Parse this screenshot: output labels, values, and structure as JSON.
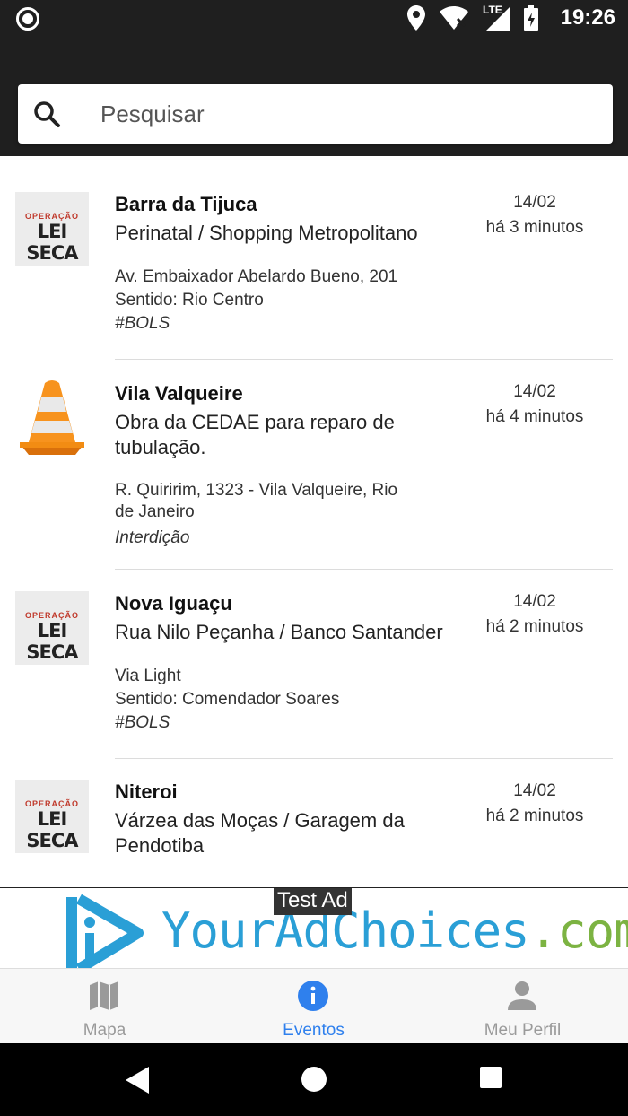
{
  "status_bar": {
    "time": "19:26",
    "network": "LTE"
  },
  "search": {
    "placeholder": "Pesquisar"
  },
  "events": [
    {
      "place": "Barra da Tijuca",
      "description": "Perinatal / Shopping Metropolitano",
      "details": [
        "Av. Embaixador Abelardo Bueno, 201",
        "Sentido: Rio Centro"
      ],
      "tag": "#BOLS",
      "date": "14/02",
      "ago": "há 3 minutos",
      "icon": "lei-seca",
      "icon_top": "OPERAÇÃO",
      "icon_main": "LEI SECA"
    },
    {
      "place": "Vila Valqueire",
      "description": "Obra da CEDAE para reparo de tubulação.",
      "details": [
        "R. Quiririm, 1323 - Vila Valqueire, Rio de Janeiro"
      ],
      "tag": "Interdição",
      "date": "14/02",
      "ago": "há 4 minutos",
      "icon": "traffic-cone"
    },
    {
      "place": "Nova Iguaçu",
      "description": "Rua Nilo Peçanha / Banco Santander",
      "details": [
        "Via Light",
        "Sentido: Comendador Soares"
      ],
      "tag": "#BOLS",
      "date": "14/02",
      "ago": "há 2 minutos",
      "icon": "lei-seca",
      "icon_top": "OPERAÇÃO",
      "icon_main": "LEI SECA"
    },
    {
      "place": "Niteroi",
      "description": "Várzea das Moças / Garagem da Pendotiba",
      "details": [],
      "tag": "",
      "date": "14/02",
      "ago": "há 2 minutos",
      "icon": "lei-seca",
      "icon_top": "OPERAÇÃO",
      "icon_main": "LEI SECA"
    }
  ],
  "ad": {
    "label": "Test Ad",
    "brand_main": "YourAdChoices",
    "brand_suffix": ".com"
  },
  "bottom_nav": [
    {
      "label": "Mapa",
      "icon": "map-icon",
      "active": false
    },
    {
      "label": "Eventos",
      "icon": "info-icon",
      "active": true
    },
    {
      "label": "Meu Perfil",
      "icon": "person-icon",
      "active": false
    }
  ],
  "colors": {
    "accent": "#2f80ed",
    "topbar": "#1f1f1f",
    "ad_blue": "#2a9fd6",
    "ad_green": "#7cb342"
  }
}
